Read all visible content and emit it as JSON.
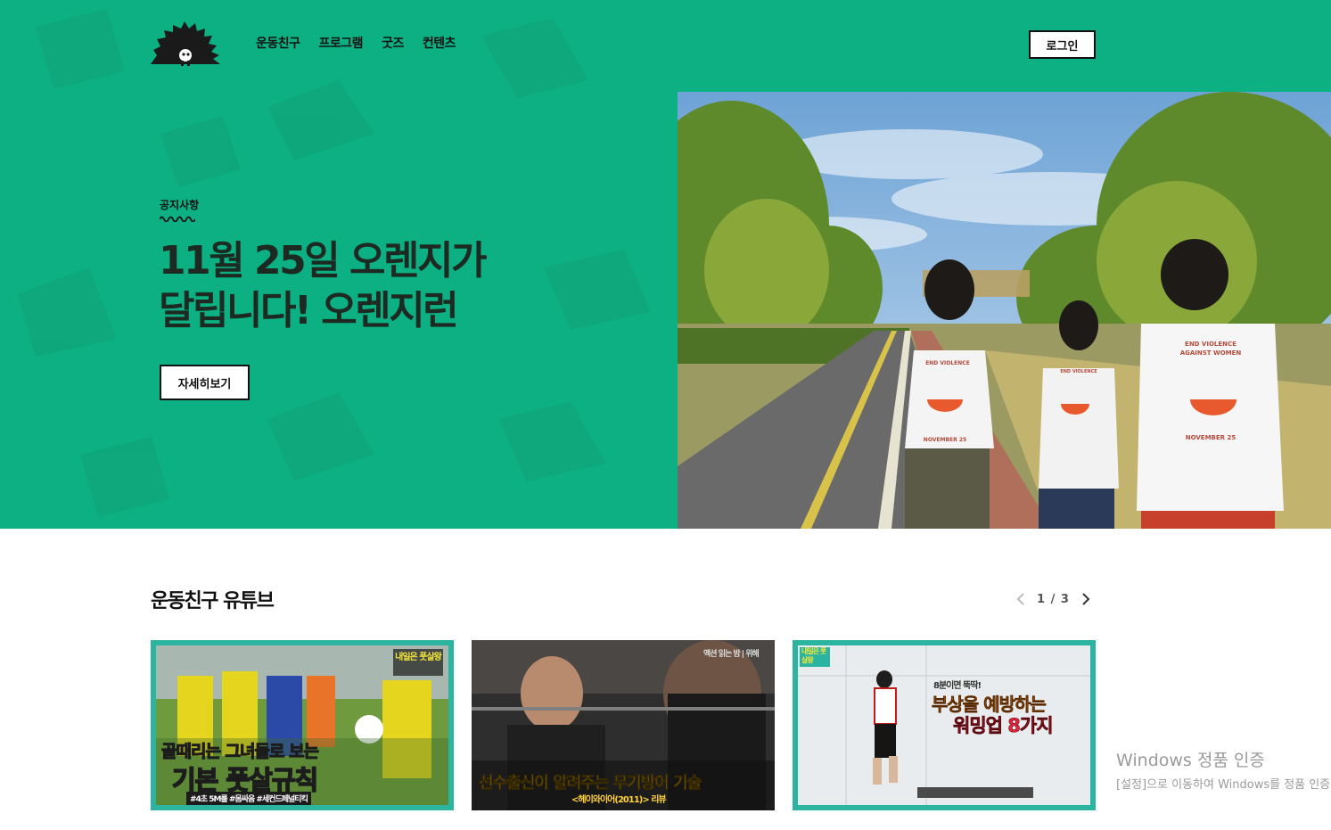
{
  "colors": {
    "hero_bg": "#0db083",
    "text_dark": "#1d2a22",
    "button_border": "#111111"
  },
  "nav": {
    "items": [
      "운동친구",
      "프로그램",
      "굿즈",
      "컨텐츠"
    ],
    "login_label": "로그인"
  },
  "hero": {
    "label": "공지사항",
    "title": "11월 25일 오렌지가\n달립니다! 오렌지런",
    "button_label": "자세히보기",
    "shirt_text": [
      "END VIOLENCE",
      "AGAINST WOMEN",
      "NOVEMBER 25"
    ]
  },
  "youtube": {
    "title": "운동친구 유튜브",
    "pager": "1 / 3",
    "cards": [
      {
        "badge": "내일은 풋살왕",
        "line1": "골때리는 그녀들로 보는",
        "line2": "기본 풋살규칙",
        "tags": "#4초 5M룰 #몸싸움 #세컨드페널티킥"
      },
      {
        "top": "액션 읽는 밤 | 위해",
        "line1": "선수출신이 알려주는 무기방어 기술",
        "sub": "<헤이와이어(2011)> 리뷰"
      },
      {
        "badge": "내일은 풋살왕",
        "small": "8분이면 뚝딱!",
        "line1": "부상을 예방하는",
        "line2": "워밍업 8가지"
      }
    ]
  },
  "watermark": {
    "line1": "Windows 정품 인증",
    "line2": "[설정]으로 이동하여 Windows를 정품 인증합니다."
  }
}
